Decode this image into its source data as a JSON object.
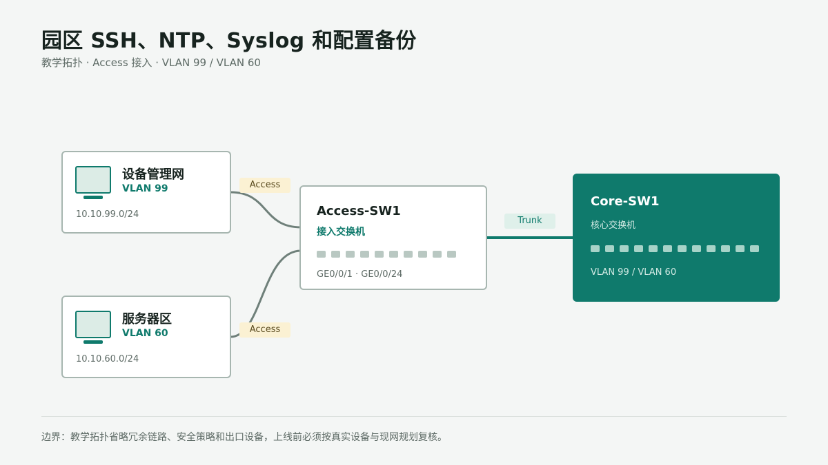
{
  "header": {
    "title": "园区 SSH、NTP、Syslog 和配置备份",
    "subtitle": "教学拓扑 · Access 接入 · VLAN 99 / VLAN 60"
  },
  "hosts": [
    {
      "name": "设备管理网",
      "vlan": "VLAN 99",
      "subnet": "10.10.99.0/24",
      "icon": "monitor-icon"
    },
    {
      "name": "服务器区",
      "vlan": "VLAN 60",
      "subnet": "10.10.60.0/24",
      "icon": "monitor-icon"
    }
  ],
  "access_switch": {
    "name": "Access-SW1",
    "role": "接入交换机",
    "port_count": 10,
    "interfaces": "GE0/0/1 · GE0/0/24"
  },
  "core_switch": {
    "name": "Core-SW1",
    "role": "核心交换机",
    "port_count": 12,
    "vlans": "VLAN 99 / VLAN 60"
  },
  "links": {
    "mgmt_label": "Access",
    "server_label": "Access",
    "uplink_label": "Trunk"
  },
  "colors": {
    "accent": "#0f7a6c",
    "link": "#6f807a",
    "access_badge": "#fbf1d3",
    "trunk_badge": "#dff0ea"
  },
  "footer": {
    "note": "边界：教学拓扑省略冗余链路、安全策略和出口设备，上线前必须按真实设备与现网规划复核。"
  }
}
